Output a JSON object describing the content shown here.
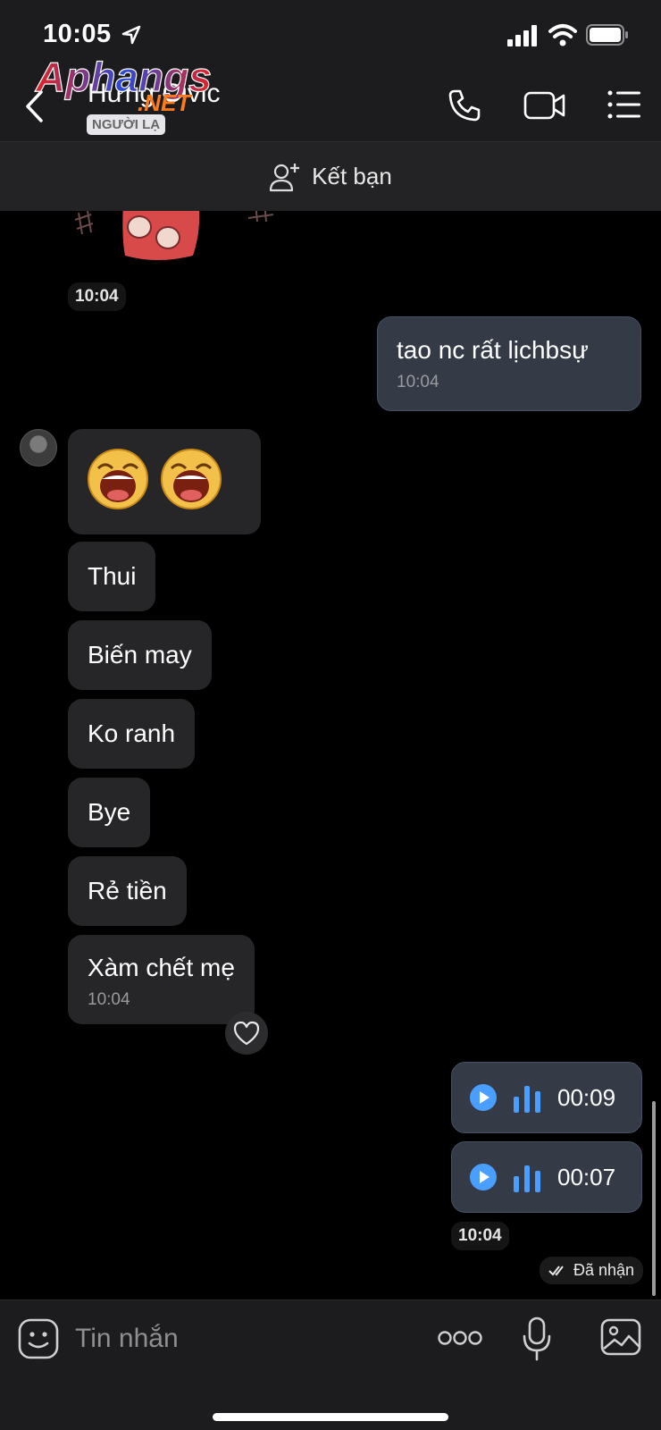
{
  "status_bar": {
    "time": "10:05"
  },
  "header": {
    "contact_name": "Hưng Civic",
    "badge": "NGƯỜI LẠ",
    "logo_text": "Aphangs",
    "logo_sub": ".NET"
  },
  "friend_bar": {
    "label": "Kết bạn"
  },
  "chat": {
    "sticker_time": "10:04",
    "outgoing_text": {
      "text": "tao nc rất lịchbsự",
      "time": "10:04"
    },
    "incoming": [
      {
        "text": "Thui"
      },
      {
        "text": "Biến may"
      },
      {
        "text": "Ko ranh"
      },
      {
        "text": "Bye"
      },
      {
        "text": "Rẻ tiền"
      },
      {
        "text": "Xàm chết mẹ",
        "time": "10:04"
      }
    ],
    "voice_messages": [
      {
        "duration": "00:09"
      },
      {
        "duration": "00:07"
      }
    ],
    "voice_time": "10:04",
    "status": "Đã nhận"
  },
  "input": {
    "placeholder": "Tin nhắn"
  },
  "colors": {
    "background": "#000000",
    "bar": "#1c1c1e",
    "incoming_bubble": "#262628",
    "outgoing_bubble": "#343a46",
    "accent_blue": "#4a9eff"
  }
}
